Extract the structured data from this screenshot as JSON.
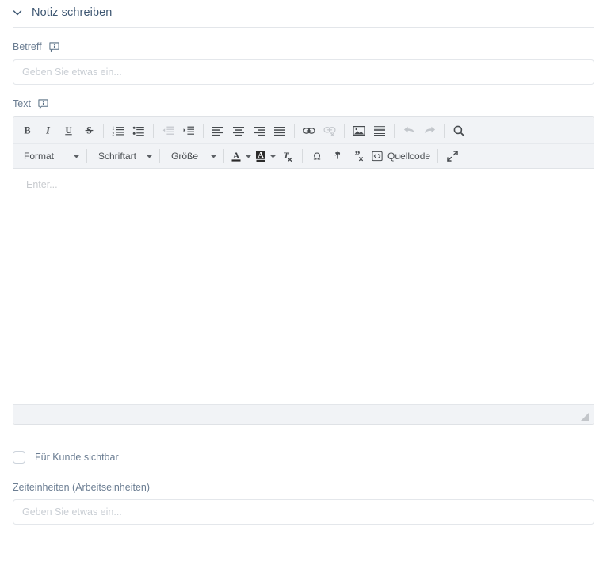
{
  "panel": {
    "title": "Notiz schreiben",
    "collapse_icon": "chevron-down-icon"
  },
  "fields": {
    "subject": {
      "label": "Betreff",
      "info_icon": "info-tooltip-icon",
      "value": "",
      "placeholder": "Geben Sie etwas ein..."
    },
    "text": {
      "label": "Text",
      "info_icon": "info-tooltip-icon"
    },
    "time_units": {
      "label": "Zeiteinheiten (Arbeitseinheiten)",
      "value": "",
      "placeholder": "Geben Sie etwas ein..."
    }
  },
  "editor": {
    "placeholder": "Enter...",
    "content": "",
    "toolbar_row1": [
      {
        "name": "bold-button",
        "icon": "bold-icon",
        "label": "B",
        "disabled": false
      },
      {
        "name": "italic-button",
        "icon": "italic-icon",
        "label": "I",
        "disabled": false
      },
      {
        "name": "underline-button",
        "icon": "underline-icon",
        "label": "U",
        "disabled": false
      },
      {
        "name": "strikethrough-button",
        "icon": "strikethrough-icon",
        "label": "S",
        "disabled": false
      },
      {
        "name": "separator",
        "icon": "separator",
        "label": "",
        "disabled": false
      },
      {
        "name": "numbered-list-button",
        "icon": "numbered-list-icon",
        "label": "",
        "disabled": false
      },
      {
        "name": "bulleted-list-button",
        "icon": "bulleted-list-icon",
        "label": "",
        "disabled": false
      },
      {
        "name": "separator",
        "icon": "separator",
        "label": "",
        "disabled": false
      },
      {
        "name": "decrease-indent-button",
        "icon": "outdent-icon",
        "label": "",
        "disabled": true
      },
      {
        "name": "increase-indent-button",
        "icon": "indent-icon",
        "label": "",
        "disabled": false
      },
      {
        "name": "separator",
        "icon": "separator",
        "label": "",
        "disabled": false
      },
      {
        "name": "align-left-button",
        "icon": "align-left-icon",
        "label": "",
        "disabled": false
      },
      {
        "name": "align-center-button",
        "icon": "align-center-icon",
        "label": "",
        "disabled": false
      },
      {
        "name": "align-right-button",
        "icon": "align-right-icon",
        "label": "",
        "disabled": false
      },
      {
        "name": "align-justify-button",
        "icon": "align-justify-icon",
        "label": "",
        "disabled": false
      },
      {
        "name": "separator",
        "icon": "separator",
        "label": "",
        "disabled": false
      },
      {
        "name": "insert-link-button",
        "icon": "link-icon",
        "label": "",
        "disabled": false
      },
      {
        "name": "remove-link-button",
        "icon": "unlink-icon",
        "label": "",
        "disabled": true
      },
      {
        "name": "separator",
        "icon": "separator",
        "label": "",
        "disabled": false
      },
      {
        "name": "insert-image-button",
        "icon": "image-icon",
        "label": "",
        "disabled": false
      },
      {
        "name": "horizontal-rule-button",
        "icon": "horizontal-rule-icon",
        "label": "",
        "disabled": false
      },
      {
        "name": "separator",
        "icon": "separator",
        "label": "",
        "disabled": false
      },
      {
        "name": "undo-button",
        "icon": "undo-arrow-icon",
        "label": "",
        "disabled": true
      },
      {
        "name": "redo-button",
        "icon": "redo-arrow-icon",
        "label": "",
        "disabled": true
      },
      {
        "name": "separator",
        "icon": "separator",
        "label": "",
        "disabled": false
      },
      {
        "name": "find-button",
        "icon": "search-magnifier-icon",
        "label": "",
        "disabled": false
      }
    ],
    "combos": {
      "format": {
        "label": "Format",
        "caret_icon": "caret-down-icon"
      },
      "font": {
        "label": "Schriftart",
        "caret_icon": "caret-down-icon"
      },
      "size": {
        "label": "Größe",
        "caret_icon": "caret-down-icon"
      }
    },
    "toolbar_row2": {
      "text_color": {
        "name": "text-color-button",
        "icon": "text-color-icon",
        "caret_icon": "caret-down-icon"
      },
      "bg_color": {
        "name": "background-color-button",
        "icon": "background-color-icon",
        "caret_icon": "caret-down-icon"
      },
      "remove_format": {
        "name": "remove-format-button",
        "icon": "remove-format-icon"
      },
      "special_char": {
        "name": "special-character-button",
        "icon": "omega-icon",
        "label": "Ω"
      },
      "insert_quote": {
        "name": "insert-quote-button",
        "icon": "insert-quote-icon"
      },
      "remove_quote": {
        "name": "remove-quote-button",
        "icon": "remove-quote-icon"
      },
      "source": {
        "name": "source-code-button",
        "icon": "source-code-icon",
        "label": "Quellcode"
      },
      "maximize": {
        "name": "maximize-button",
        "icon": "maximize-icon"
      }
    },
    "resize_grip": "resize-grip-icon"
  },
  "checkbox": {
    "label": "Für Kunde sichtbar",
    "checked": false
  },
  "colors": {
    "panel_title": "#3f5873",
    "label": "#6b7d92",
    "toolbar_bg": "#f1f3f6",
    "border": "#dfe2e6",
    "placeholder": "#c9ced4",
    "icon": "#474b4f",
    "icon_disabled": "#c2c6cb"
  }
}
